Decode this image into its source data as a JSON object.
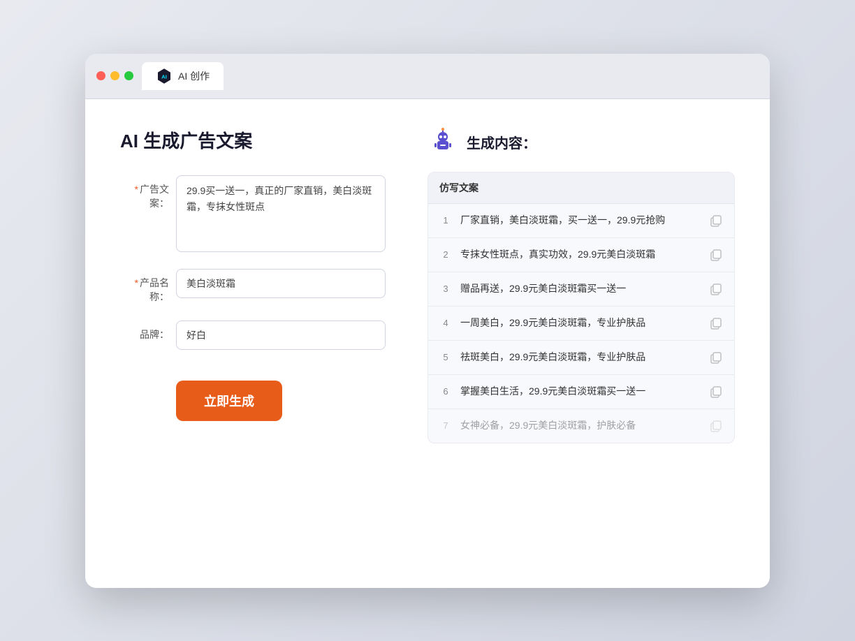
{
  "browser": {
    "tab_label": "AI 创作"
  },
  "page": {
    "title": "AI 生成广告文案",
    "result_title": "生成内容："
  },
  "form": {
    "ad_copy_label": "广告文案：",
    "product_name_label": "产品名称：",
    "brand_label": "品牌：",
    "ad_copy_value": "29.9买一送一，真正的厂家直销，美白淡斑霜，专抹女性斑点",
    "product_name_value": "美白淡斑霜",
    "brand_value": "好白",
    "generate_button": "立即生成"
  },
  "results": {
    "column_header": "仿写文案",
    "items": [
      {
        "num": "1",
        "text": "厂家直销，美白淡斑霜，买一送一，29.9元抢购",
        "faded": false
      },
      {
        "num": "2",
        "text": "专抹女性斑点，真实功效，29.9元美白淡斑霜",
        "faded": false
      },
      {
        "num": "3",
        "text": "赠品再送，29.9元美白淡斑霜买一送一",
        "faded": false
      },
      {
        "num": "4",
        "text": "一周美白，29.9元美白淡斑霜，专业护肤品",
        "faded": false
      },
      {
        "num": "5",
        "text": "祛斑美白，29.9元美白淡斑霜，专业护肤品",
        "faded": false
      },
      {
        "num": "6",
        "text": "掌握美白生活，29.9元美白淡斑霜买一送一",
        "faded": false
      },
      {
        "num": "7",
        "text": "女神必备，29.9元美白淡斑霜，护肤必备",
        "faded": true
      }
    ]
  }
}
